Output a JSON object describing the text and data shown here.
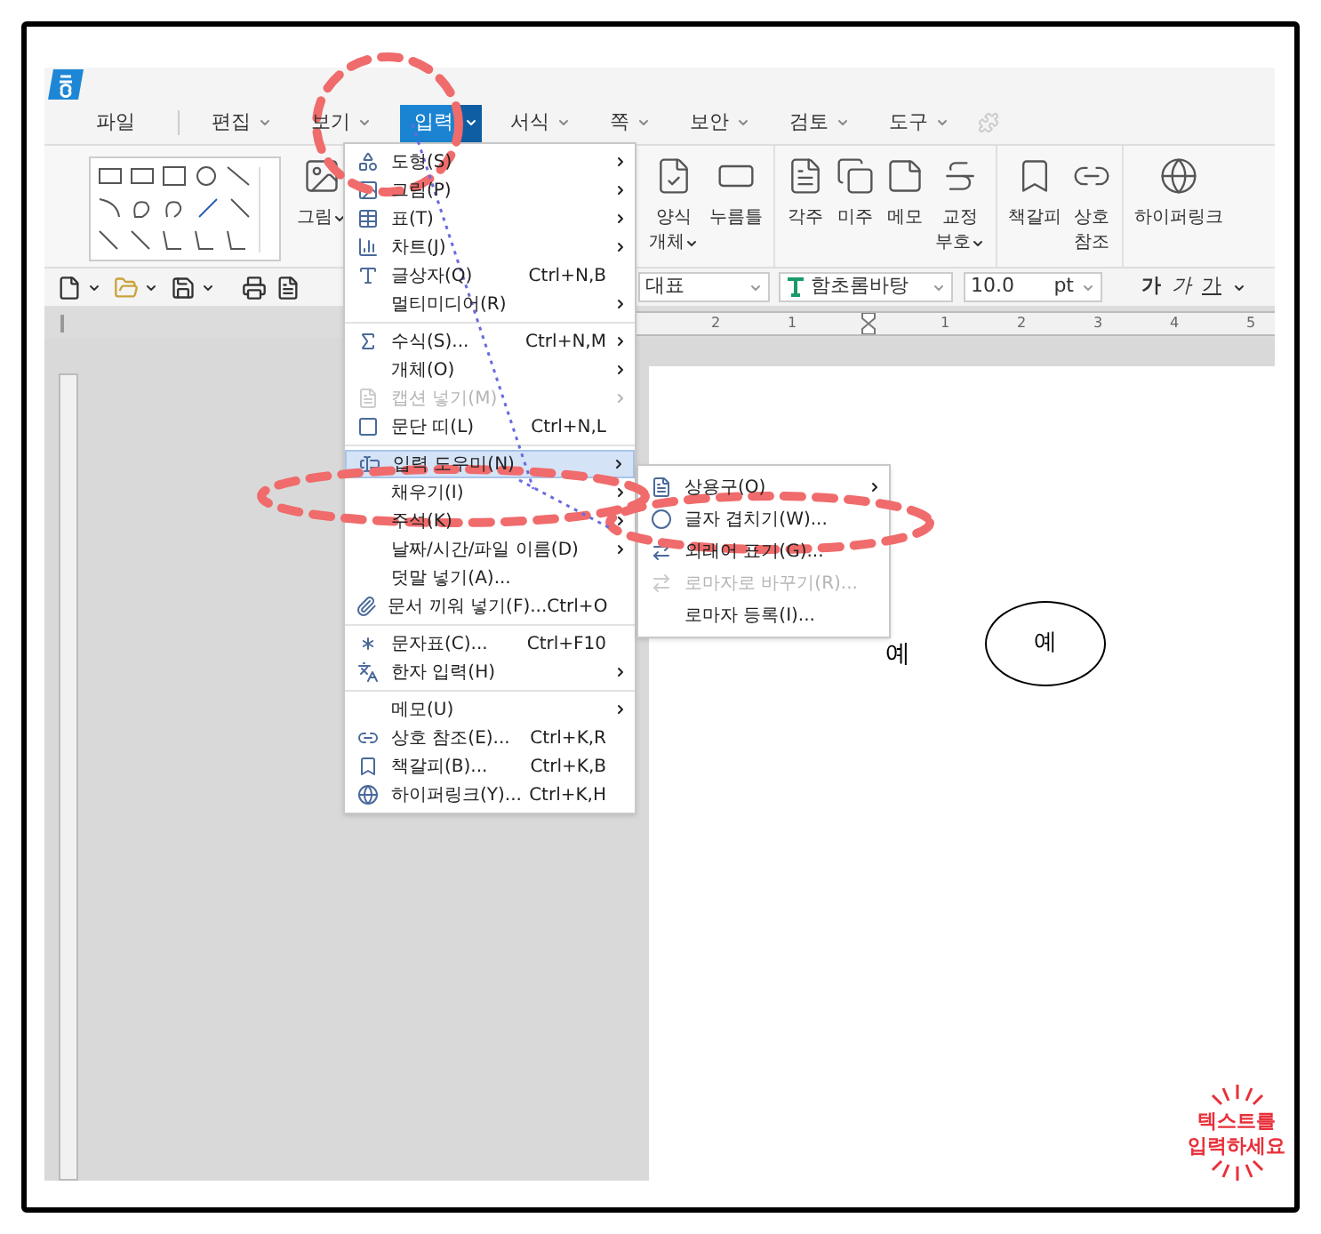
{
  "menu_bar": [
    {
      "label": "파일",
      "dropdown": false,
      "selected": false
    },
    {
      "label": "편집",
      "dropdown": true,
      "selected": false
    },
    {
      "label": "보기",
      "dropdown": true,
      "selected": false
    },
    {
      "label": "입력",
      "dropdown": true,
      "selected": true
    },
    {
      "label": "서식",
      "dropdown": true,
      "selected": false
    },
    {
      "label": "쪽",
      "dropdown": true,
      "selected": false
    },
    {
      "label": "보안",
      "dropdown": true,
      "selected": false
    },
    {
      "label": "검토",
      "dropdown": true,
      "selected": false
    },
    {
      "label": "도구",
      "dropdown": true,
      "selected": false
    }
  ],
  "ribbon": {
    "picture_button": {
      "lines": [
        "그림"
      ],
      "dropdown": true
    },
    "groups": [
      [
        {
          "lines": [
            "양식",
            "개체"
          ],
          "dropdown": true
        },
        {
          "lines": [
            "누름틀"
          ],
          "dropdown": false
        }
      ],
      [
        {
          "lines": [
            "각주"
          ],
          "dropdown": false
        },
        {
          "lines": [
            "미주"
          ],
          "dropdown": false
        },
        {
          "lines": [
            "메모"
          ],
          "dropdown": false
        },
        {
          "lines": [
            "교정",
            "부호"
          ],
          "dropdown": true
        }
      ],
      [
        {
          "lines": [
            "책갈피"
          ],
          "dropdown": false
        },
        {
          "lines": [
            "상호",
            "참조"
          ],
          "dropdown": false
        }
      ],
      [
        {
          "lines": [
            "하이퍼링크"
          ],
          "dropdown": false
        }
      ]
    ]
  },
  "toolbar": {
    "style": "대표",
    "font": "함초롬바탕",
    "size": "10.0",
    "unit": "pt",
    "format_buttons": [
      {
        "label": "가",
        "kind": "bold"
      },
      {
        "label": "가",
        "kind": "italic"
      },
      {
        "label": "가",
        "kind": "underline"
      }
    ]
  },
  "ruler": {
    "labels": [
      "2",
      "1",
      "1",
      "2",
      "3",
      "4",
      "5"
    ]
  },
  "menu": {
    "sections": [
      [
        {
          "label": "도형(S)",
          "submenu": true,
          "disabled": false,
          "selected": false
        },
        {
          "label": "그림(P)",
          "submenu": true,
          "disabled": false,
          "selected": false
        },
        {
          "label": "표(T)",
          "submenu": true,
          "disabled": false,
          "selected": false
        },
        {
          "label": "차트(J)",
          "submenu": true,
          "disabled": false,
          "selected": false
        },
        {
          "label": "글상자(Q)",
          "shortcut": "Ctrl+N,B",
          "submenu": false,
          "disabled": false,
          "selected": false
        },
        {
          "label": "멀티미디어(R)",
          "submenu": true,
          "disabled": false,
          "selected": false
        }
      ],
      [
        {
          "label": "수식(S)...",
          "shortcut": "Ctrl+N,M",
          "submenu": true,
          "disabled": false,
          "selected": false
        },
        {
          "label": "개체(O)",
          "submenu": true,
          "disabled": false,
          "selected": false
        },
        {
          "label": "캡션 넣기(M)",
          "submenu": true,
          "disabled": true,
          "selected": false
        },
        {
          "label": "문단 띠(L)",
          "shortcut": "Ctrl+N,L",
          "submenu": false,
          "disabled": false,
          "selected": false
        }
      ],
      [
        {
          "label": "입력 도우미(N)",
          "submenu": true,
          "disabled": false,
          "selected": true
        },
        {
          "label": "채우기(I)",
          "submenu": true,
          "disabled": false,
          "selected": false
        },
        {
          "label": "주석(K)",
          "submenu": true,
          "disabled": false,
          "selected": false
        },
        {
          "label": "날짜/시간/파일 이름(D)",
          "submenu": true,
          "disabled": false,
          "selected": false
        },
        {
          "label": "덧말 넣기(A)...",
          "submenu": false,
          "disabled": false,
          "selected": false
        },
        {
          "label": "문서 끼워 넣기(F)...",
          "shortcut": "Ctrl+O",
          "submenu": false,
          "disabled": false,
          "selected": false
        }
      ],
      [
        {
          "label": "문자표(C)...",
          "shortcut": "Ctrl+F10",
          "submenu": false,
          "disabled": false,
          "selected": false
        },
        {
          "label": "한자 입력(H)",
          "submenu": true,
          "disabled": false,
          "selected": false
        }
      ],
      [
        {
          "label": "메모(U)",
          "submenu": true,
          "disabled": false,
          "selected": false
        },
        {
          "label": "상호 참조(E)...",
          "shortcut": "Ctrl+K,R",
          "submenu": false,
          "disabled": false,
          "selected": false
        },
        {
          "label": "책갈피(B)...",
          "shortcut": "Ctrl+K,B",
          "submenu": false,
          "disabled": false,
          "selected": false
        },
        {
          "label": "하이퍼링크(Y)...",
          "shortcut": "Ctrl+K,H",
          "submenu": false,
          "disabled": false,
          "selected": false
        }
      ]
    ]
  },
  "submenu": {
    "items": [
      {
        "label": "상용구(O)",
        "submenu": true,
        "disabled": false
      },
      {
        "label": "글자 겹치기(W)...",
        "submenu": false,
        "disabled": false
      },
      {
        "label": "외래어 표기(G)...",
        "submenu": false,
        "disabled": false
      },
      {
        "label": "로마자로 바꾸기(R)...",
        "submenu": false,
        "disabled": true
      },
      {
        "label": "로마자 등록(I)...",
        "submenu": false,
        "disabled": false
      }
    ]
  },
  "document": {
    "text": "예",
    "shape_text": "예"
  },
  "annotation": {
    "lines": [
      "텍스트를",
      "입력하세요"
    ]
  }
}
